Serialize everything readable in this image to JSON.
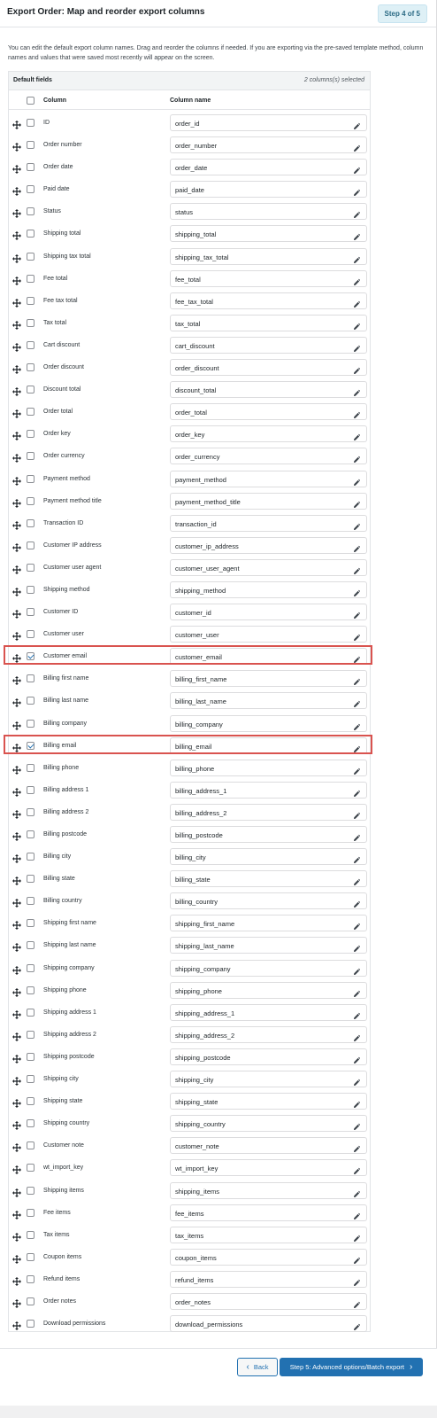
{
  "header": {
    "title": "Export Order: Map and reorder export columns",
    "step_badge": "Step 4 of 5"
  },
  "description": "You can edit the default export column names. Drag and reorder the columns if needed. If you are exporting via the pre-saved template method, column names and values that were saved most recently will appear on the screen.",
  "section": {
    "title": "Default fields",
    "selected_count": "2 columns(s) selected"
  },
  "table": {
    "col_column": "Column",
    "col_column_name": "Column name"
  },
  "icons": {
    "drag": "move-arrows-icon",
    "edit": "pencil-icon",
    "back": "chevron-left-icon",
    "next": "chevron-right-icon"
  },
  "colors": {
    "primary": "#2271b1",
    "highlight": "#d9534f"
  },
  "rows": [
    {
      "label": "ID",
      "name": "order_id",
      "checked": false
    },
    {
      "label": "Order number",
      "name": "order_number",
      "checked": false
    },
    {
      "label": "Order date",
      "name": "order_date",
      "checked": false
    },
    {
      "label": "Paid date",
      "name": "paid_date",
      "checked": false
    },
    {
      "label": "Status",
      "name": "status",
      "checked": false
    },
    {
      "label": "Shipping total",
      "name": "shipping_total",
      "checked": false
    },
    {
      "label": "Shipping tax total",
      "name": "shipping_tax_total",
      "checked": false
    },
    {
      "label": "Fee total",
      "name": "fee_total",
      "checked": false
    },
    {
      "label": "Fee tax total",
      "name": "fee_tax_total",
      "checked": false
    },
    {
      "label": "Tax total",
      "name": "tax_total",
      "checked": false
    },
    {
      "label": "Cart discount",
      "name": "cart_discount",
      "checked": false
    },
    {
      "label": "Order discount",
      "name": "order_discount",
      "checked": false
    },
    {
      "label": "Discount total",
      "name": "discount_total",
      "checked": false
    },
    {
      "label": "Order total",
      "name": "order_total",
      "checked": false
    },
    {
      "label": "Order key",
      "name": "order_key",
      "checked": false
    },
    {
      "label": "Order currency",
      "name": "order_currency",
      "checked": false
    },
    {
      "label": "Payment method",
      "name": "payment_method",
      "checked": false
    },
    {
      "label": "Payment method title",
      "name": "payment_method_title",
      "checked": false
    },
    {
      "label": "Transaction ID",
      "name": "transaction_id",
      "checked": false
    },
    {
      "label": "Customer IP address",
      "name": "customer_ip_address",
      "checked": false
    },
    {
      "label": "Customer user agent",
      "name": "customer_user_agent",
      "checked": false
    },
    {
      "label": "Shipping method",
      "name": "shipping_method",
      "checked": false
    },
    {
      "label": "Customer ID",
      "name": "customer_id",
      "checked": false
    },
    {
      "label": "Customer user",
      "name": "customer_user",
      "checked": false
    },
    {
      "label": "Customer email",
      "name": "customer_email",
      "checked": true
    },
    {
      "label": "Billing first name",
      "name": "billing_first_name",
      "checked": false
    },
    {
      "label": "Billing last name",
      "name": "billing_last_name",
      "checked": false
    },
    {
      "label": "Billing company",
      "name": "billing_company",
      "checked": false
    },
    {
      "label": "Billing email",
      "name": "billing_email",
      "checked": true
    },
    {
      "label": "Billing phone",
      "name": "billing_phone",
      "checked": false
    },
    {
      "label": "Billing address 1",
      "name": "billing_address_1",
      "checked": false
    },
    {
      "label": "Billing address 2",
      "name": "billing_address_2",
      "checked": false
    },
    {
      "label": "Billing postcode",
      "name": "billing_postcode",
      "checked": false
    },
    {
      "label": "Billing city",
      "name": "billing_city",
      "checked": false
    },
    {
      "label": "Billing state",
      "name": "billing_state",
      "checked": false
    },
    {
      "label": "Billing country",
      "name": "billing_country",
      "checked": false
    },
    {
      "label": "Shipping first name",
      "name": "shipping_first_name",
      "checked": false
    },
    {
      "label": "Shipping last name",
      "name": "shipping_last_name",
      "checked": false
    },
    {
      "label": "Shipping company",
      "name": "shipping_company",
      "checked": false
    },
    {
      "label": "Shipping phone",
      "name": "shipping_phone",
      "checked": false
    },
    {
      "label": "Shipping address 1",
      "name": "shipping_address_1",
      "checked": false
    },
    {
      "label": "Shipping address 2",
      "name": "shipping_address_2",
      "checked": false
    },
    {
      "label": "Shipping postcode",
      "name": "shipping_postcode",
      "checked": false
    },
    {
      "label": "Shipping city",
      "name": "shipping_city",
      "checked": false
    },
    {
      "label": "Shipping state",
      "name": "shipping_state",
      "checked": false
    },
    {
      "label": "Shipping country",
      "name": "shipping_country",
      "checked": false
    },
    {
      "label": "Customer note",
      "name": "customer_note",
      "checked": false
    },
    {
      "label": "wt_import_key",
      "name": "wt_import_key",
      "checked": false
    },
    {
      "label": "Shipping items",
      "name": "shipping_items",
      "checked": false
    },
    {
      "label": "Fee items",
      "name": "fee_items",
      "checked": false
    },
    {
      "label": "Tax items",
      "name": "tax_items",
      "checked": false
    },
    {
      "label": "Coupon items",
      "name": "coupon_items",
      "checked": false
    },
    {
      "label": "Refund items",
      "name": "refund_items",
      "checked": false
    },
    {
      "label": "Order notes",
      "name": "order_notes",
      "checked": false
    },
    {
      "label": "Download permissions",
      "name": "download_permissions",
      "checked": false
    }
  ],
  "footer": {
    "back_label": "Back",
    "next_label": "Step 5: Advanced options/Batch export"
  }
}
